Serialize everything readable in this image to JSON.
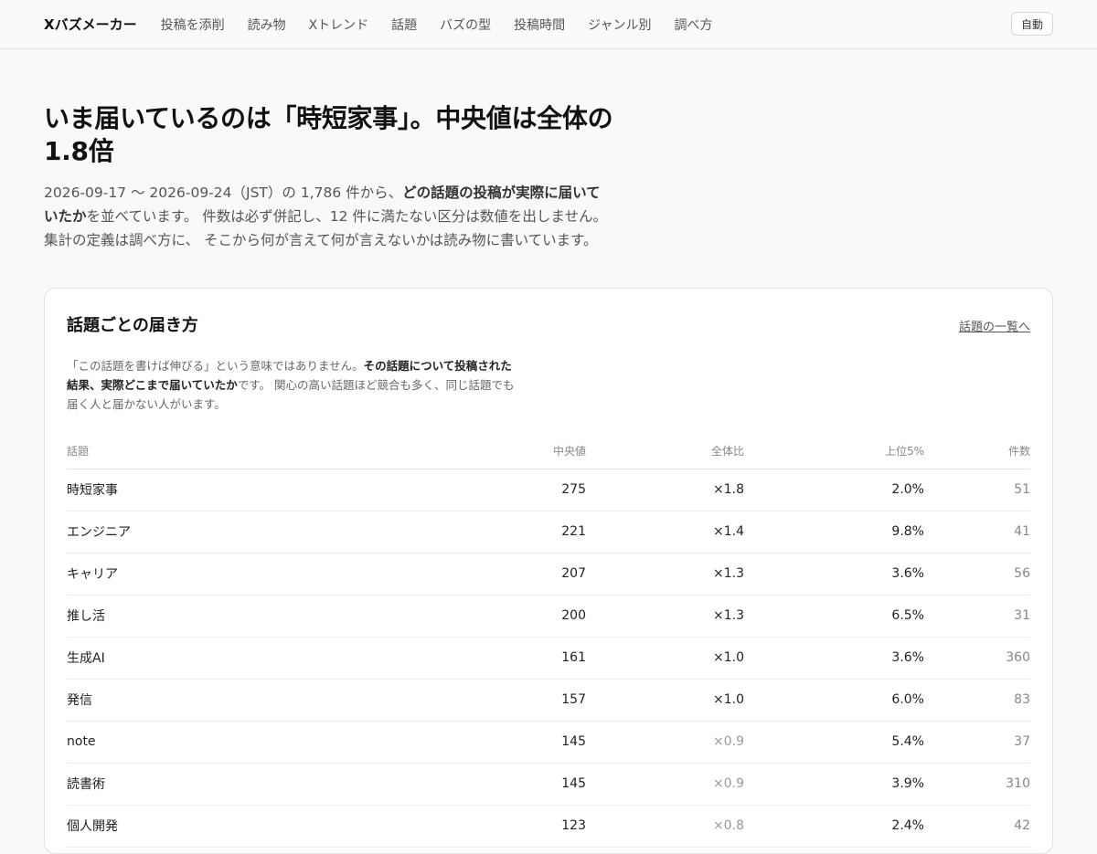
{
  "header": {
    "brand": "Xバズメーカー",
    "nav": [
      "投稿を添削",
      "読み物",
      "Xトレンド",
      "話題",
      "バズの型",
      "投稿時間",
      "ジャンル別",
      "調べ方"
    ],
    "mode_button": "自動"
  },
  "hero": {
    "title": "いま届いているのは「時短家事」。中央値は全体の1.8倍",
    "intro_1": "2026-09-17 〜 2026-09-24（JST）の 1,786 件から、",
    "intro_bold": "どの話題の投稿が実際に届いていたか",
    "intro_2": "を並べています。 件数は必ず併記し、12 件に満たない区分は数値を出しません。 集計の定義は調べ方に、 そこから何が言えて何が言えないかは読み物に書いています。"
  },
  "card": {
    "title": "話題ごとの届き方",
    "link": "話題の一覧へ",
    "desc_1": "「この話題を書けば伸びる」という意味ではありません。",
    "desc_bold": "その話題について投稿された結果、実際どこまで届いていたか",
    "desc_2": "です。 関心の高い話題ほど競合も多く、同じ話題でも届く人と届かない人がいます。"
  },
  "table": {
    "headers": {
      "topic": "話題",
      "median": "中央値",
      "ratio": "全体比",
      "top5": "上位5%",
      "count": "件数"
    },
    "rows": [
      {
        "topic": "時短家事",
        "median": "275",
        "ratio": "×1.8",
        "top5": "2.0%",
        "count": "51"
      },
      {
        "topic": "エンジニア",
        "median": "221",
        "ratio": "×1.4",
        "top5": "9.8%",
        "count": "41"
      },
      {
        "topic": "キャリア",
        "median": "207",
        "ratio": "×1.3",
        "top5": "3.6%",
        "count": "56"
      },
      {
        "topic": "推し活",
        "median": "200",
        "ratio": "×1.3",
        "top5": "6.5%",
        "count": "31"
      },
      {
        "topic": "生成AI",
        "median": "161",
        "ratio": "×1.0",
        "top5": "3.6%",
        "count": "360"
      },
      {
        "topic": "発信",
        "median": "157",
        "ratio": "×1.0",
        "top5": "6.0%",
        "count": "83"
      },
      {
        "topic": "note",
        "median": "145",
        "ratio": "×0.9",
        "top5": "5.4%",
        "count": "37"
      },
      {
        "topic": "読書術",
        "median": "145",
        "ratio": "×0.9",
        "top5": "3.9%",
        "count": "310"
      },
      {
        "topic": "個人開発",
        "median": "123",
        "ratio": "×0.8",
        "top5": "2.4%",
        "count": "42"
      }
    ]
  }
}
